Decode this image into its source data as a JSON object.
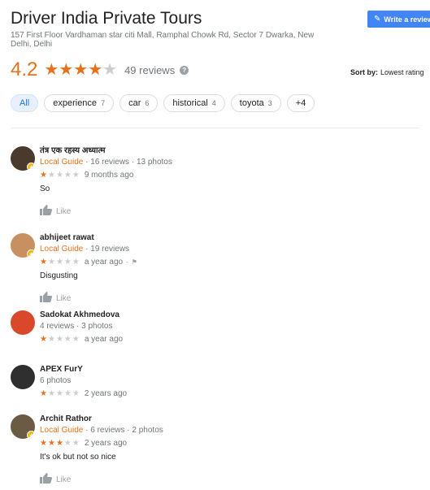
{
  "place": {
    "title": "Driver India Private Tours",
    "address": "157 First Floor Vardhaman star citi Mall, Ramphal Chowk Rd, Sector 7 Dwarka, New Delhi, Delhi"
  },
  "actions": {
    "write_review": "Write a review"
  },
  "summary": {
    "rating": "4.2",
    "stars": 4,
    "review_count": "49 reviews",
    "help_icon": "help-circle-icon"
  },
  "sort": {
    "label": "Sort by:",
    "value": "Lowest rating"
  },
  "filters": [
    {
      "label": "All",
      "count": "",
      "selected": true
    },
    {
      "label": "experience",
      "count": "7"
    },
    {
      "label": "car",
      "count": "6"
    },
    {
      "label": "historical",
      "count": "4"
    },
    {
      "label": "toyota",
      "count": "3"
    },
    {
      "label": "+4",
      "count": ""
    }
  ],
  "reviews": [
    {
      "name": "तंत्र एक रहस्य अध्यात्म",
      "local_guide": "Local Guide",
      "meta": " · 16 reviews · 13 photos",
      "stars": 1,
      "time": "9 months ago",
      "flag": false,
      "text": "So",
      "like_label": "Like",
      "avatar_color": "#4a3a2e"
    },
    {
      "name": "abhijeet rawat",
      "local_guide": "Local Guide",
      "meta": " · 19 reviews",
      "stars": 1,
      "time": "a year ago",
      "flag": true,
      "text": "Disgusting",
      "like_label": "Like",
      "avatar_color": "#c89060"
    },
    {
      "name": "Sadokat Akhmedova",
      "local_guide": "",
      "meta": "4 reviews · 3 photos",
      "stars": 1,
      "time": "a year ago",
      "flag": false,
      "text": "",
      "like_label": "",
      "avatar_color": "#d9482b"
    },
    {
      "name": "APEX FurY",
      "local_guide": "",
      "meta": "6 photos",
      "stars": 1,
      "time": "2 years ago",
      "flag": false,
      "text": "",
      "like_label": "",
      "avatar_color": "#2f2f2f"
    },
    {
      "name": "Archit Rathor",
      "local_guide": "Local Guide",
      "meta": " · 6 reviews · 2 photos",
      "stars": 3,
      "time": "2 years ago",
      "flag": false,
      "text": "It's ok but not so nice",
      "like_label": "Like",
      "avatar_color": "#6b5a44"
    }
  ],
  "colors": {
    "accent": "#e7711b",
    "star_on": "#e7711b",
    "star_off": "#cccccc",
    "button": "#4285f4"
  }
}
